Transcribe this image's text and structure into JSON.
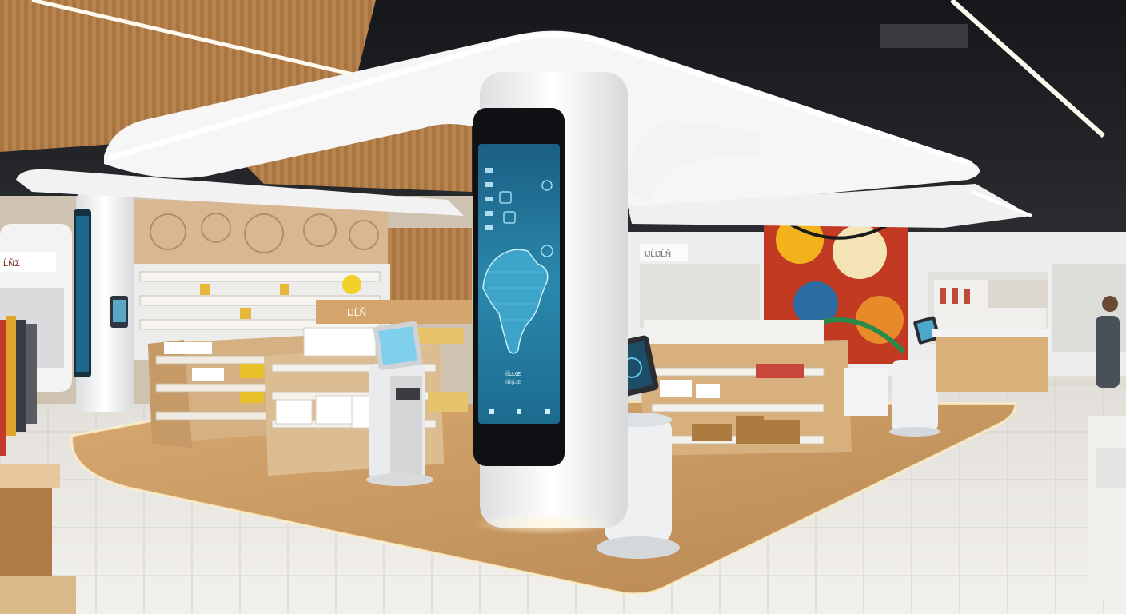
{
  "scene": {
    "kind": "retail store interior with a central digital kiosk pillar",
    "sign_left": "ĹŇƩ",
    "sign_center": "ĲĹŇ",
    "sign_back": "ĲĹĲĹŇ",
    "screen": {
      "caption_line1": "İĺĿĿŒ",
      "caption_line2": "ŇĺĲĹŒ"
    }
  },
  "colors": {
    "ceiling_dark": "#1e2024",
    "wood": "#c89a66",
    "white_structure": "#f1f2f2",
    "screen_blue": "#1e6f95",
    "floor": "#e9e6e1",
    "accent_glow": "#fff4da",
    "mural_red": "#c23a22"
  }
}
